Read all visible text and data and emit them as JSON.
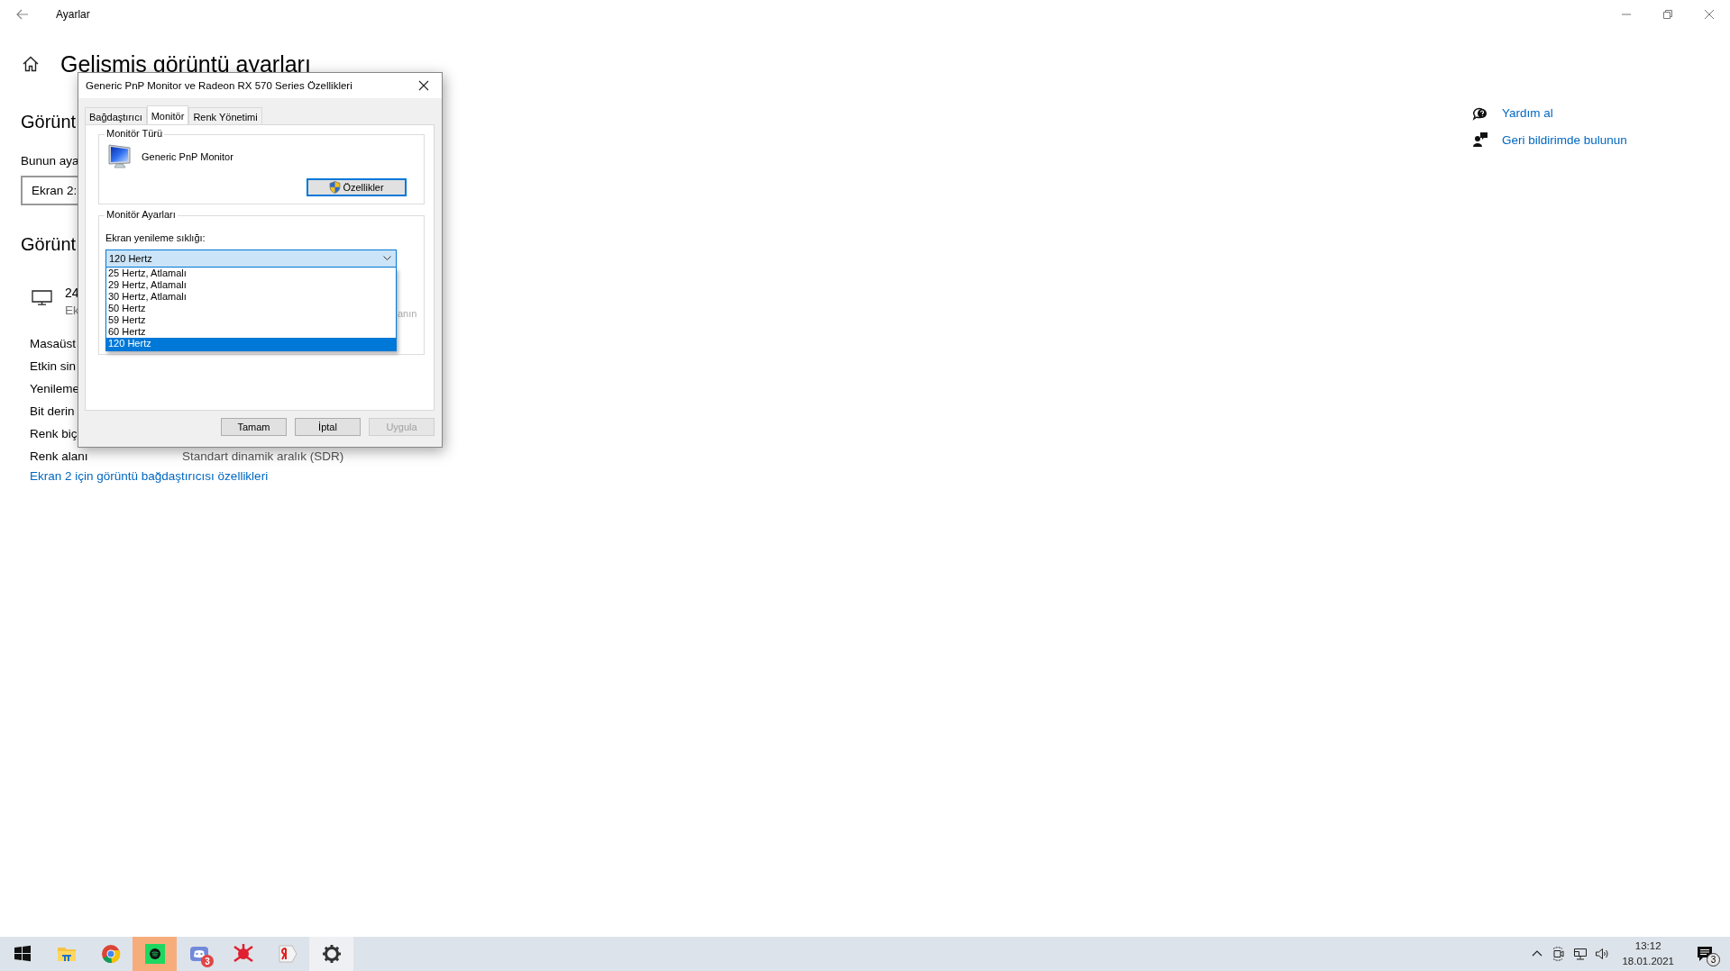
{
  "window": {
    "title": "Ayarlar"
  },
  "page": {
    "title": "Gelişmiş görüntü ayarları",
    "section_1": "Görünt",
    "prompt": "Bunun aya",
    "display_select": "Ekran 2:",
    "section_2": "Görünt",
    "display": {
      "name": "24",
      "subtitle": "Ek"
    },
    "info_rows": [
      {
        "label": "Masaüst"
      },
      {
        "label": "Etkin sin"
      },
      {
        "label": "Yenileme"
      },
      {
        "label": "Bit derin"
      },
      {
        "label": "Renk biç"
      },
      {
        "label": "Renk alanı",
        "value": "Standart dinamik aralık (SDR)"
      }
    ],
    "link": "Ekran 2 için görüntü bağdaştırıcısı özellikleri"
  },
  "help_links": [
    {
      "kind": "help",
      "label": "Yardım al"
    },
    {
      "kind": "feedback",
      "label": "Geri bildirimde bulunun"
    }
  ],
  "dialog": {
    "title": "Generic PnP Monitor ve Radeon RX 570 Series Özellikleri",
    "tabs": [
      {
        "label": "Bağdaştırıcı",
        "selected": false
      },
      {
        "label": "Monitör",
        "selected": true
      },
      {
        "label": "Renk Yönetimi",
        "selected": false
      }
    ],
    "monitor_type": {
      "legend": "Monitör Türü",
      "name": "Generic PnP Monitor",
      "button": "Özellikler"
    },
    "monitor_settings": {
      "legend": "Monitör Ayarları",
      "label": "Ekran yenileme sıklığı:",
      "value": "120 Hertz",
      "partial_text": "anın",
      "options": [
        {
          "label": "25 Hertz, Atlamalı",
          "selected": false
        },
        {
          "label": "29 Hertz, Atlamalı",
          "selected": false
        },
        {
          "label": "30 Hertz, Atlamalı",
          "selected": false
        },
        {
          "label": "50 Hertz",
          "selected": false
        },
        {
          "label": "59 Hertz",
          "selected": false
        },
        {
          "label": "60 Hertz",
          "selected": false
        },
        {
          "label": "120 Hertz",
          "selected": true
        }
      ]
    },
    "buttons": [
      {
        "label": "Tamam",
        "disabled": false
      },
      {
        "label": "İptal",
        "disabled": false
      },
      {
        "label": "Uygula",
        "disabled": true
      }
    ]
  },
  "taskbar": {
    "apps": [
      {
        "kind": "start",
        "flashing": false,
        "open": false
      },
      {
        "kind": "folder",
        "flashing": false,
        "open": false
      },
      {
        "kind": "browser",
        "flashing": false,
        "open": false
      },
      {
        "kind": "music",
        "flashing": true,
        "open": false
      },
      {
        "kind": "chat",
        "flashing": false,
        "open": false,
        "badge": "3"
      },
      {
        "kind": "star",
        "flashing": false,
        "open": false
      },
      {
        "kind": "letter",
        "flashing": false,
        "open": false
      },
      {
        "kind": "gear",
        "flashing": false,
        "open": true
      }
    ],
    "time": "13:12",
    "date": "18.01.2021",
    "notification_count": "3"
  }
}
